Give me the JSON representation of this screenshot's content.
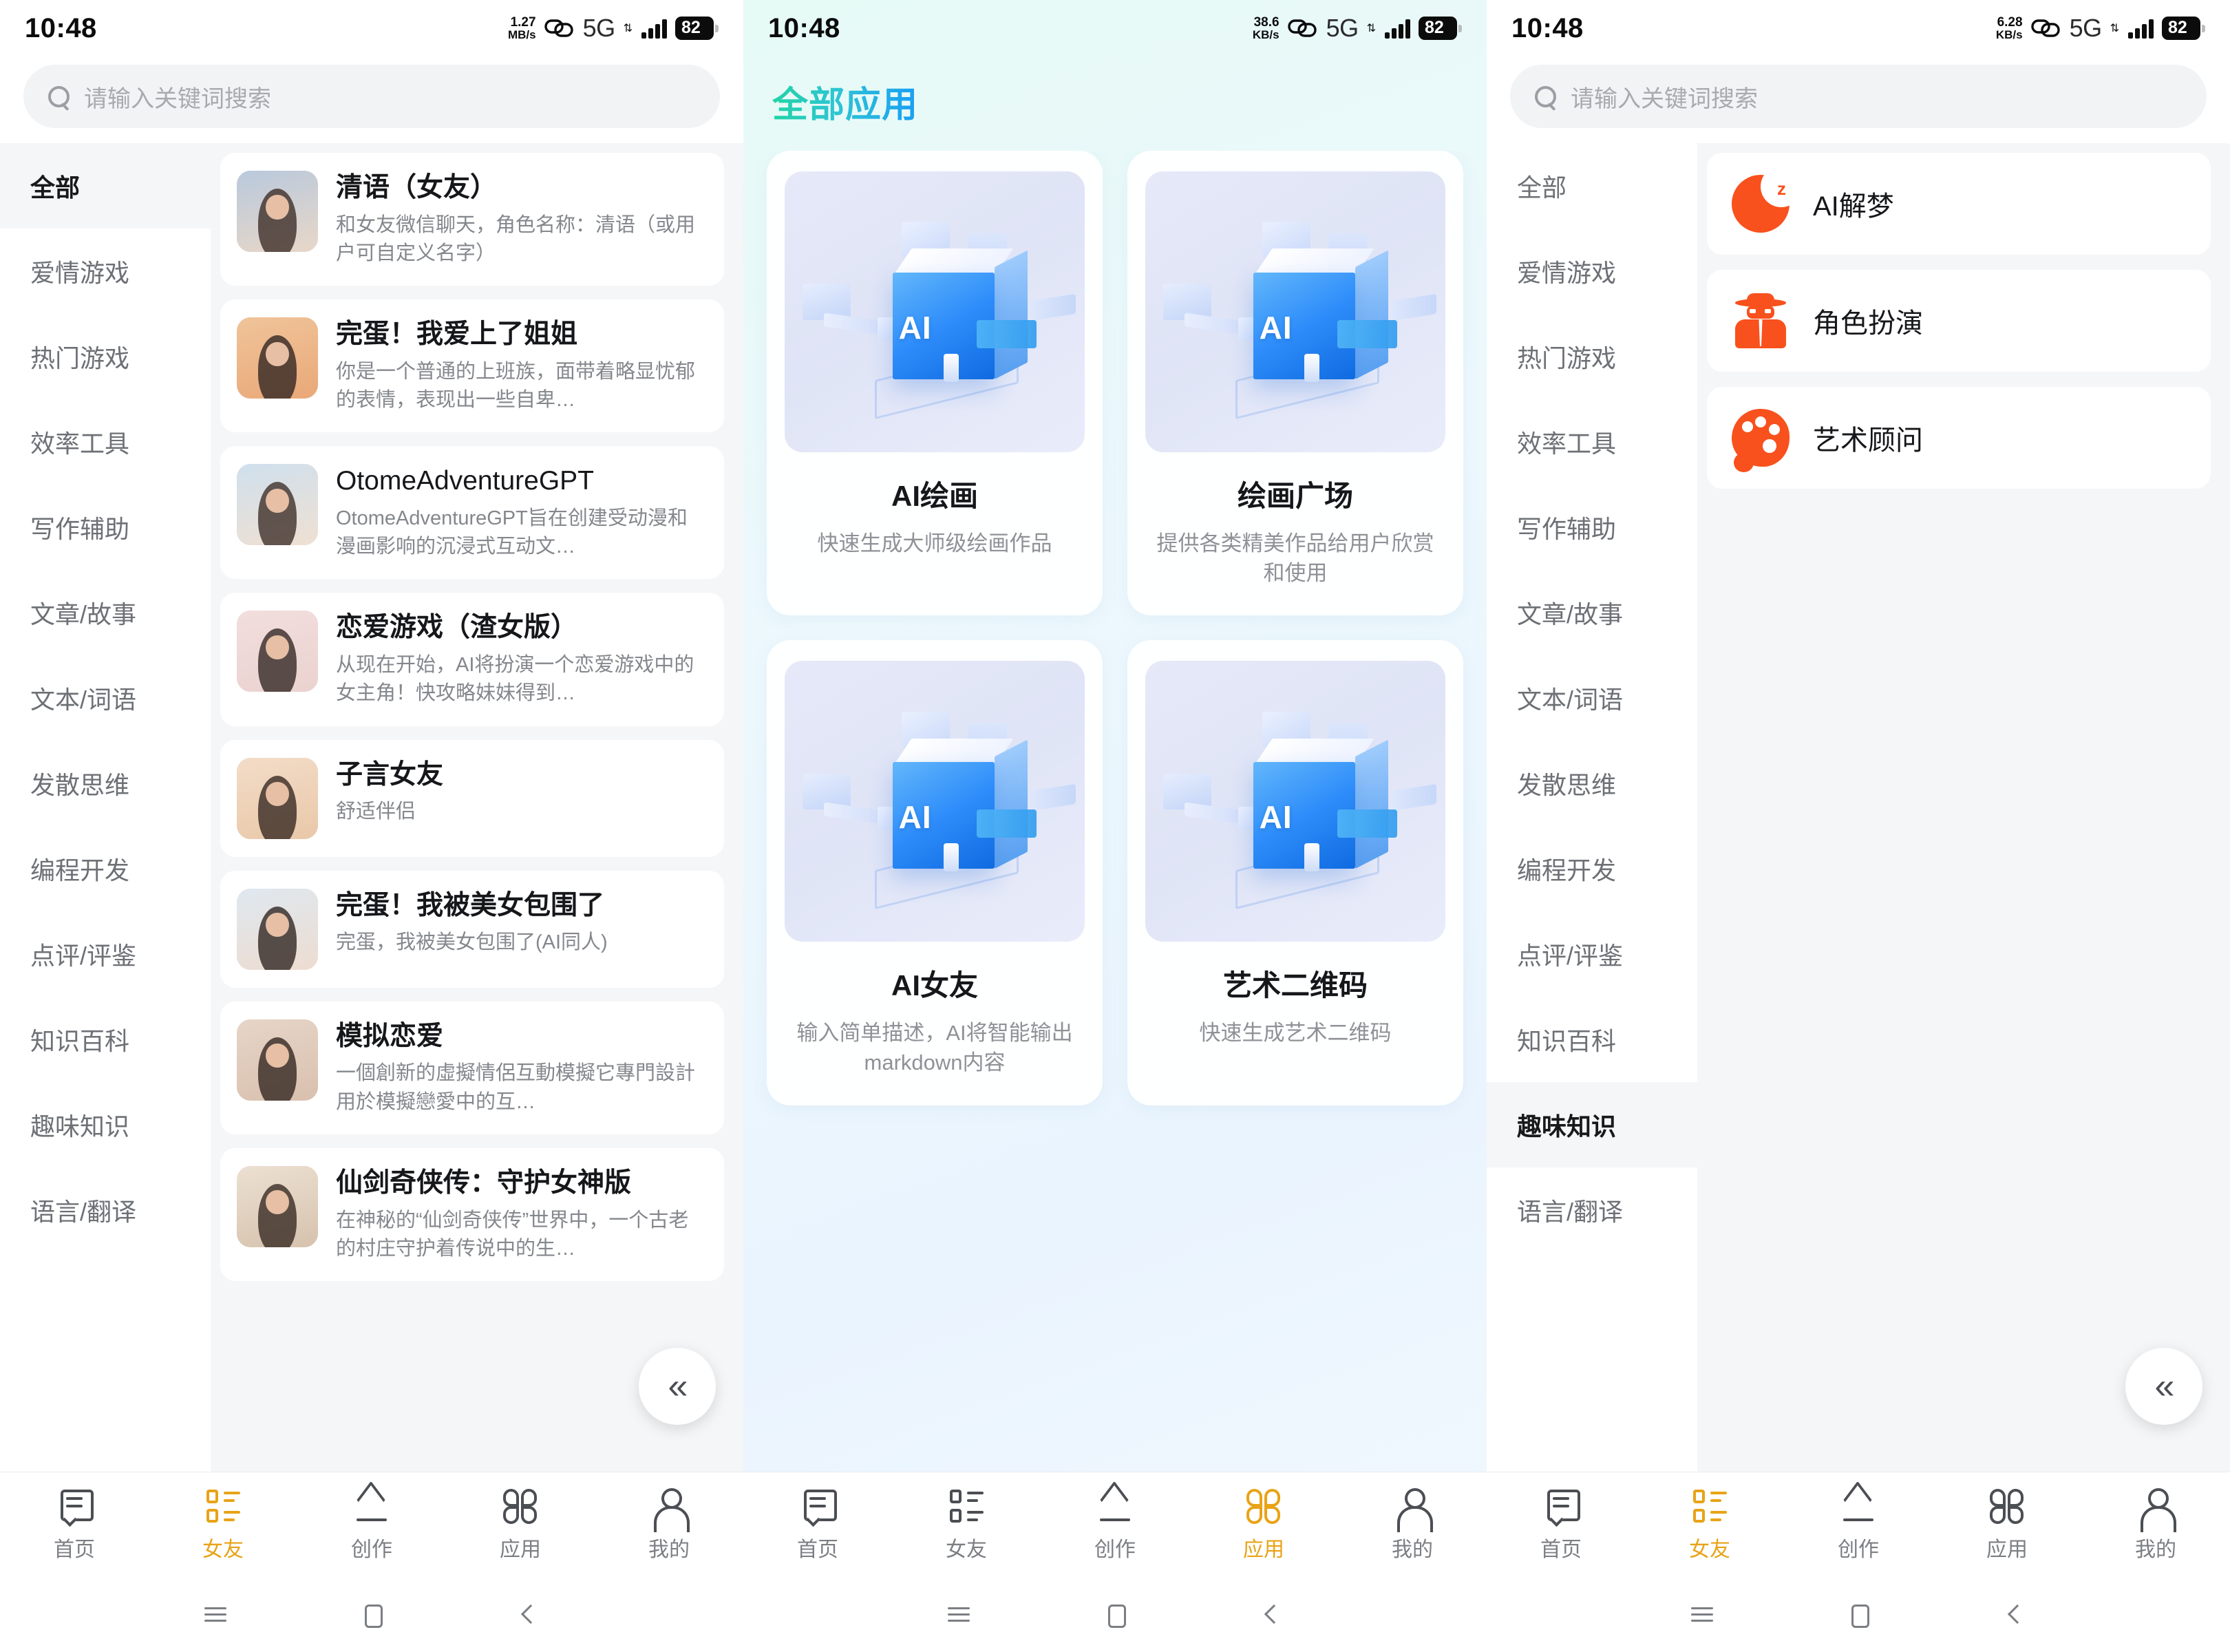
{
  "status_bar": {
    "time": "10:48",
    "network_type": "5G",
    "battery": "82",
    "speeds": [
      "1.27",
      "38.6",
      "6.28"
    ],
    "speed_units": [
      "MB/s",
      "KB/s",
      "KB/s"
    ]
  },
  "search": {
    "placeholder": "请输入关键词搜索"
  },
  "categories": [
    "全部",
    "爱情游戏",
    "热门游戏",
    "效率工具",
    "写作辅助",
    "文章/故事",
    "文本/词语",
    "发散思维",
    "编程开发",
    "点评/评鉴",
    "知识百科",
    "趣味知识",
    "语言/翻译"
  ],
  "left_panel": {
    "active_category": "全部",
    "items": [
      {
        "title": "清语（女友）",
        "desc": "和女友微信聊天，角色名称：清语（或用户可自定义名字）"
      },
      {
        "title": "完蛋！我爱上了姐姐",
        "desc": "你是一个普通的上班族，面带着略显忧郁的表情，表现出一些自卑…"
      },
      {
        "title": "OtomeAdventureGPT",
        "desc": "OtomeAdventureGPT旨在创建受动漫和漫画影响的沉浸式互动文…"
      },
      {
        "title": "恋爱游戏（渣女版）",
        "desc": "从现在开始，AI将扮演一个恋爱游戏中的女主角！快攻略妹妹得到…"
      },
      {
        "title": "子言女友",
        "desc": "舒适伴侣"
      },
      {
        "title": "完蛋！我被美女包围了",
        "desc": "完蛋，我被美女包围了(AI同人)"
      },
      {
        "title": "模拟恋爱",
        "desc": "一個創新的虛擬情侶互動模擬它專門設計用於模擬戀愛中的互…"
      },
      {
        "title": "仙剑奇侠传：守护女神版",
        "desc": "在神秘的“仙剑奇侠传”世界中，一个古老的村庄守护着传说中的生…"
      }
    ]
  },
  "mid_panel": {
    "title": "全部应用",
    "apps": [
      {
        "name": "AI绘画",
        "desc": "快速生成大师级绘画作品"
      },
      {
        "name": "绘画广场",
        "desc": "提供各类精美作品给用户欣赏和使用"
      },
      {
        "name": "AI女友",
        "desc": "输入简单描述，AI将智能输出markdown内容"
      },
      {
        "name": "艺术二维码",
        "desc": "快速生成艺术二维码"
      }
    ]
  },
  "right_panel": {
    "active_category": "趣味知识",
    "items": [
      {
        "name": "AI解梦",
        "icon": "moon-z-icon"
      },
      {
        "name": "角色扮演",
        "icon": "spy-icon"
      },
      {
        "name": "艺术顾问",
        "icon": "palette-icon"
      }
    ]
  },
  "tab_bar": {
    "tabs": [
      "首页",
      "女友",
      "创作",
      "应用",
      "我的"
    ],
    "active_left": "女友",
    "active_mid": "应用",
    "active_right": "女友",
    "accent_color": "#e8a317"
  },
  "collapse_button": {
    "label": "«"
  },
  "colors": {
    "accent_orange": "#f9511d",
    "title_gradient_from": "#22d3a5",
    "title_gradient_to": "#1a9ef5"
  }
}
